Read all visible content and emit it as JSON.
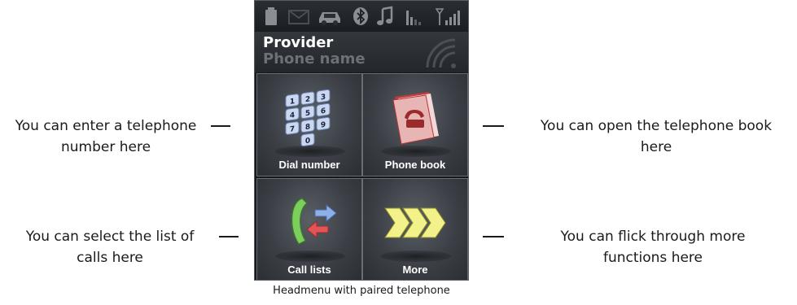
{
  "statusbar": {
    "icons": [
      "battery-icon",
      "message-icon",
      "car-icon",
      "bluetooth-icon",
      "music-note-icon",
      "signal-strength-icon",
      "antenna-signal-icon"
    ]
  },
  "header": {
    "provider": "Provider",
    "phone_name": "Phone name"
  },
  "menu": {
    "tiles": [
      {
        "label": "Dial number",
        "icon": "keypad-icon"
      },
      {
        "label": "Phone book",
        "icon": "phone-book-icon"
      },
      {
        "label": "Call lists",
        "icon": "call-lists-icon"
      },
      {
        "label": "More",
        "icon": "more-chevrons-icon"
      }
    ]
  },
  "annotations": {
    "dial_number": [
      "You can enter a telephone",
      "number here"
    ],
    "phone_book": [
      "You can open the telephone book",
      "here"
    ],
    "call_lists": [
      "You can select the list of",
      "calls here"
    ],
    "more": [
      "You can flick through more",
      "functions here"
    ]
  },
  "caption": "Headmenu with paired telephone",
  "colors": {
    "screen_bg": "#15181c",
    "tile_bg": "#3c4046",
    "text_light": "#ffffff",
    "text_muted": "#6d7177",
    "icon_gray": "#7a7e84"
  }
}
